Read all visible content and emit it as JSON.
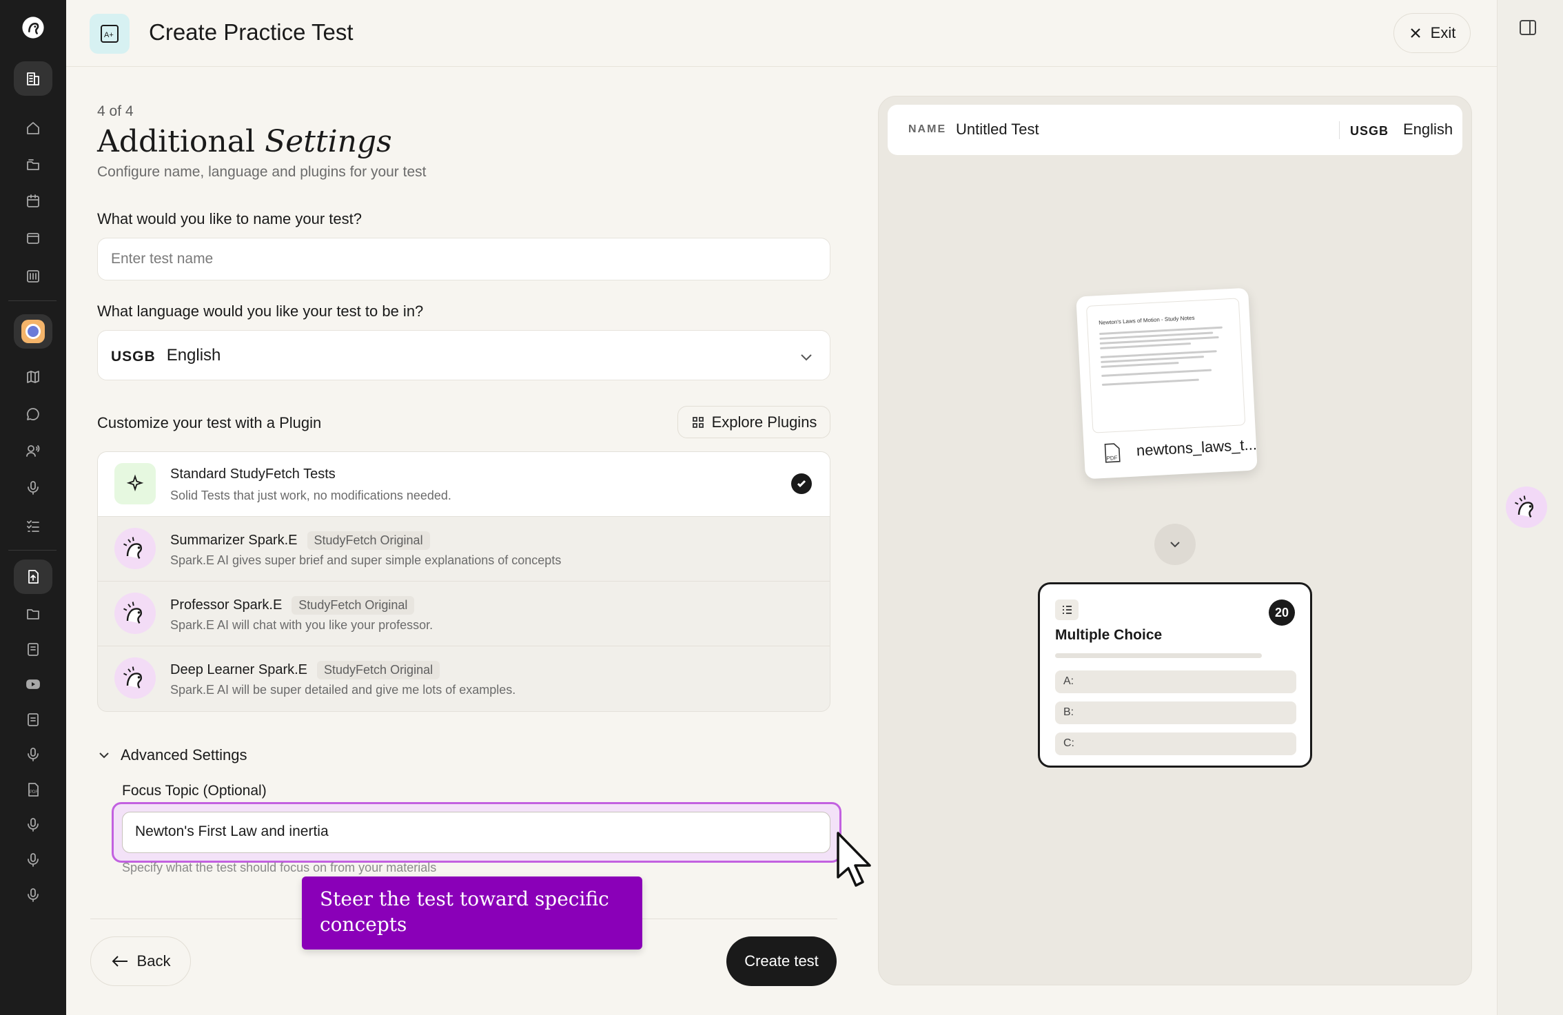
{
  "header": {
    "title": "Create Practice Test",
    "exit_label": "Exit"
  },
  "form": {
    "step": "4 of 4",
    "heading_plain": "Additional ",
    "heading_italic": "Settings",
    "subtitle": "Configure name, language and plugins for your test",
    "name_question": "What would you like to name your test?",
    "name_placeholder": "Enter test name",
    "language_question": "What language would you like your test to be in?",
    "language_code": "USGB",
    "language_value": "English",
    "plugin_heading": "Customize your test with a Plugin",
    "explore_label": "Explore Plugins",
    "plugins": [
      {
        "name": "Standard StudyFetch Tests",
        "tag": "",
        "desc": "Solid Tests that just work, no modifications needed.",
        "selected": true
      },
      {
        "name": "Summarizer Spark.E",
        "tag": "StudyFetch Original",
        "desc": "Spark.E AI gives super brief and super simple explanations of concepts"
      },
      {
        "name": "Professor Spark.E",
        "tag": "StudyFetch Original",
        "desc": "Spark.E AI will chat with you like your professor."
      },
      {
        "name": "Deep Learner Spark.E",
        "tag": "StudyFetch Original",
        "desc": "Spark.E AI will be super detailed and give me lots of examples."
      }
    ],
    "advanced_label": "Advanced Settings",
    "focus_label": "Focus Topic (Optional)",
    "focus_value": "Newton's First Law and inertia",
    "focus_hint": "Specify what the test should focus on from your materials",
    "back_label": "Back",
    "create_label": "Create test"
  },
  "callout": {
    "text": "Steer the test toward specific concepts"
  },
  "preview": {
    "name_label": "NAME",
    "name_value": "Untitled Test",
    "language_code": "USGB",
    "language_value": "English",
    "doc_title": "Newton's Laws of Motion - Study Notes",
    "file_name": "newtons_laws_t...",
    "question_type": "Multiple Choice",
    "question_count": "20",
    "options": [
      "A:",
      "B:",
      "C:"
    ]
  },
  "icons": {
    "rail": [
      "logo-icon",
      "building-icon",
      "home-icon",
      "folder-stack-icon",
      "calendar-icon",
      "window-icon",
      "library-icon",
      "workspace-icon",
      "map-icon",
      "chat-icon",
      "voice-chat-icon",
      "microphone-icon",
      "checklist-icon",
      "upload-doc-icon",
      "folder-icon",
      "notes-icon",
      "youtube-icon",
      "document-icon",
      "microphone-icon",
      "pdf-icon",
      "microphone-icon",
      "microphone-icon",
      "microphone-icon"
    ]
  },
  "colors": {
    "accent_purple": "#8a00b8",
    "focus_ring": "#c261e0",
    "rail_bg": "#1c1c1c",
    "page_bg": "#f7f5f0"
  }
}
